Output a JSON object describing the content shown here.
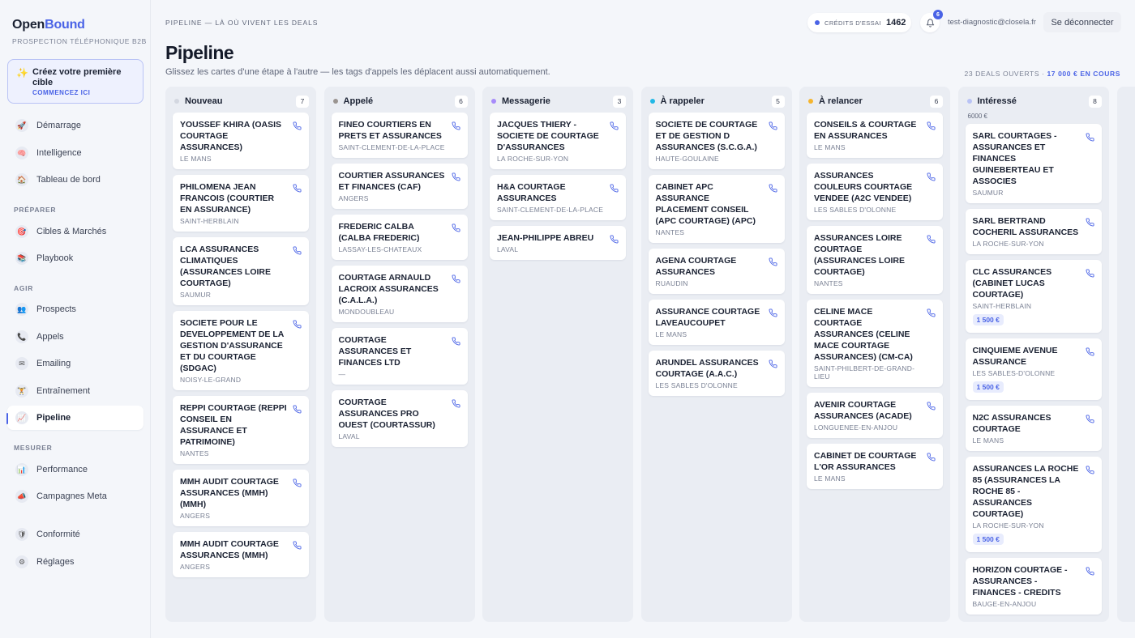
{
  "brand": {
    "part1": "Open",
    "part2": "Bound",
    "tagline": "PROSPECTION TÉLÉPHONIQUE B2B"
  },
  "cta": {
    "title": "Créez votre première cible",
    "subtitle": "COMMENCEZ ICI",
    "icon": "sparkles-icon"
  },
  "sidebar": {
    "groups": [
      {
        "label": "",
        "items": [
          {
            "label": "Démarrage",
            "icon": "rocket-icon"
          },
          {
            "label": "Intelligence",
            "icon": "brain-icon"
          },
          {
            "label": "Tableau de bord",
            "icon": "home-icon"
          }
        ]
      },
      {
        "label": "PRÉPARER",
        "items": [
          {
            "label": "Cibles & Marchés",
            "icon": "target-icon"
          },
          {
            "label": "Playbook",
            "icon": "books-icon"
          }
        ]
      },
      {
        "label": "AGIR",
        "items": [
          {
            "label": "Prospects",
            "icon": "people-icon"
          },
          {
            "label": "Appels",
            "icon": "phone-icon"
          },
          {
            "label": "Emailing",
            "icon": "envelope-icon"
          },
          {
            "label": "Entraînement",
            "icon": "trophy-icon"
          },
          {
            "label": "Pipeline",
            "icon": "chart-icon",
            "active": true
          }
        ]
      },
      {
        "label": "MESURER",
        "items": [
          {
            "label": "Performance",
            "icon": "bar-chart-icon"
          },
          {
            "label": "Campagnes Meta",
            "icon": "megaphone-icon"
          }
        ]
      },
      {
        "label": "",
        "items": [
          {
            "label": "Conformité",
            "icon": "shield-icon"
          },
          {
            "label": "Réglages",
            "icon": "gear-icon"
          }
        ]
      }
    ]
  },
  "header": {
    "breadcrumb": "PIPELINE — LÀ OÙ VIVENT LES DEALS",
    "credits_label": "CRÉDITS D'ESSAI",
    "credits_value": "1462",
    "notifications": "6",
    "email": "test-diagnostic@closela.fr",
    "logout": "Se déconnecter"
  },
  "page": {
    "title": "Pipeline",
    "subtitle": "Glissez les cartes d'une étape à l'autre — les tags d'appels les déplacent aussi automatiquement.",
    "summary_deals": "23 DEALS OUVERTS · ",
    "summary_amount": "17 000 € EN COURS"
  },
  "columns": [
    {
      "name": "Nouveau",
      "count": "7",
      "color": "#d3d7e0",
      "amount": "",
      "cards": [
        {
          "name": "YOUSSEF KHIRA (OASIS COURTAGE ASSURANCES)",
          "city": "LE MANS"
        },
        {
          "name": "PHILOMENA JEAN FRANCOIS (COURTIER EN ASSURANCE)",
          "city": "SAINT-HERBLAIN"
        },
        {
          "name": "LCA ASSURANCES CLIMATIQUES (ASSURANCES LOIRE COURTAGE)",
          "city": "SAUMUR"
        },
        {
          "name": "SOCIETE POUR LE DEVELOPPEMENT DE LA GESTION D'ASSURANCE ET DU COURTAGE (SDGAC)",
          "city": "NOISY-LE-GRAND"
        },
        {
          "name": "REPPI COURTAGE (REPPI CONSEIL EN ASSURANCE ET PATRIMOINE)",
          "city": "NANTES"
        },
        {
          "name": "MMH AUDIT COURTAGE ASSURANCES (MMH) (MMH)",
          "city": "ANGERS"
        },
        {
          "name": "MMH AUDIT COURTAGE ASSURANCES (MMH)",
          "city": "ANGERS"
        }
      ]
    },
    {
      "name": "Appelé",
      "count": "6",
      "color": "#9a9490",
      "amount": "",
      "cards": [
        {
          "name": "FINEO COURTIERS EN PRETS ET ASSURANCES",
          "city": "SAINT-CLEMENT-DE-LA-PLACE"
        },
        {
          "name": "COURTIER ASSURANCES ET FINANCES (CAF)",
          "city": "ANGERS"
        },
        {
          "name": "FREDERIC CALBA (CALBA FREDERIC)",
          "city": "LASSAY-LES-CHATEAUX"
        },
        {
          "name": "COURTAGE ARNAULD LACROIX ASSURANCES (C.A.L.A.)",
          "city": "MONDOUBLEAU"
        },
        {
          "name": "COURTAGE ASSURANCES ET FINANCES LTD",
          "city": "—"
        },
        {
          "name": "COURTAGE ASSURANCES PRO OUEST (COURTASSUR)",
          "city": "LAVAL"
        }
      ]
    },
    {
      "name": "Messagerie",
      "count": "3",
      "color": "#a78bfa",
      "amount": "",
      "cards": [
        {
          "name": "JACQUES THIERY - SOCIETE DE COURTAGE D'ASSURANCES",
          "city": "LA ROCHE-SUR-YON"
        },
        {
          "name": "H&A COURTAGE ASSURANCES",
          "city": "SAINT-CLEMENT-DE-LA-PLACE"
        },
        {
          "name": "JEAN-PHILIPPE ABREU",
          "city": "LAVAL"
        }
      ]
    },
    {
      "name": "À rappeler",
      "count": "5",
      "color": "#22b8e6",
      "amount": "",
      "cards": [
        {
          "name": "SOCIETE DE COURTAGE ET DE GESTION D ASSURANCES (S.C.G.A.)",
          "city": "HAUTE-GOULAINE"
        },
        {
          "name": "CABINET APC ASSURANCE PLACEMENT CONSEIL (APC COURTAGE) (APC)",
          "city": "NANTES"
        },
        {
          "name": "AGENA COURTAGE ASSURANCES",
          "city": "RUAUDIN"
        },
        {
          "name": "ASSURANCE COURTAGE LAVEAUCOUPET",
          "city": "LE MANS"
        },
        {
          "name": "ARUNDEL ASSURANCES COURTAGE (A.A.C.)",
          "city": "LES SABLES D'OLONNE"
        }
      ]
    },
    {
      "name": "À relancer",
      "count": "6",
      "color": "#f5b52e",
      "amount": "",
      "cards": [
        {
          "name": "CONSEILS & COURTAGE EN ASSURANCES",
          "city": "LE MANS"
        },
        {
          "name": "ASSURANCES COULEURS COURTAGE VENDEE (A2C VENDEE)",
          "city": "LES SABLES D'OLONNE"
        },
        {
          "name": "ASSURANCES LOIRE COURTAGE (ASSURANCES LOIRE COURTAGE)",
          "city": "NANTES"
        },
        {
          "name": "CELINE MACE COURTAGE ASSURANCES (CELINE MACE COURTAGE ASSURANCES) (CM-CA)",
          "city": "SAINT-PHILBERT-DE-GRAND-LIEU"
        },
        {
          "name": "AVENIR COURTAGE ASSURANCES (ACADE)",
          "city": "LONGUENEE-EN-ANJOU"
        },
        {
          "name": "CABINET DE COURTAGE L'OR ASSURANCES",
          "city": "LE MANS"
        }
      ]
    },
    {
      "name": "Intéressé",
      "count": "8",
      "color": "#b9c3f5",
      "amount": "6000 €",
      "cards": [
        {
          "name": "SARL COURTAGES - ASSURANCES ET FINANCES GUINEBERTEAU ET ASSOCIES",
          "city": "SAUMUR"
        },
        {
          "name": "SARL BERTRAND COCHERIL ASSURANCES",
          "city": "LA ROCHE-SUR-YON"
        },
        {
          "name": "CLC ASSURANCES (CABINET LUCAS COURTAGE)",
          "city": "SAINT-HERBLAIN",
          "amount": "1 500 €"
        },
        {
          "name": "CINQUIEME AVENUE ASSURANCE",
          "city": "LES SABLES-D'OLONNE",
          "amount": "1 500 €"
        },
        {
          "name": "N2C ASSURANCES COURTAGE",
          "city": "LE MANS"
        },
        {
          "name": "ASSURANCES LA ROCHE 85 (ASSURANCES LA ROCHE 85 - ASSURANCES COURTAGE)",
          "city": "LA ROCHE-SUR-YON",
          "amount": "1 500 €"
        },
        {
          "name": "HORIZON COURTAGE - ASSURANCES - FINANCES - CREDITS",
          "city": "BAUGE-EN-ANJOU"
        }
      ]
    }
  ],
  "colors": {
    "accent": "#4a63e6",
    "background": "#f4f6fa",
    "column": "#eaedf3"
  }
}
